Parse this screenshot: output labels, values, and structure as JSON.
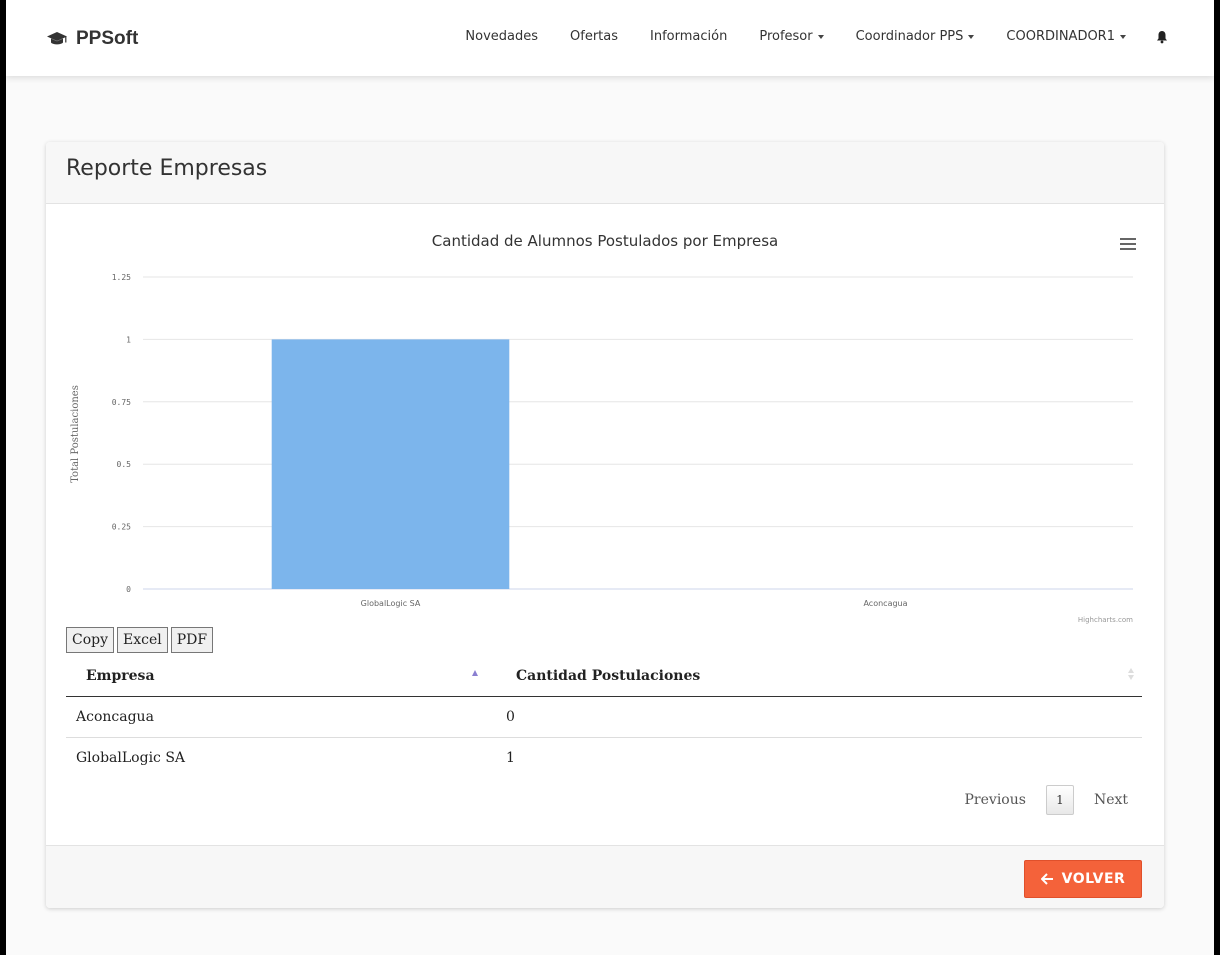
{
  "navbar": {
    "brand": "PPSoft",
    "items": [
      {
        "label": "Novedades",
        "dropdown": false
      },
      {
        "label": "Ofertas",
        "dropdown": false
      },
      {
        "label": "Información",
        "dropdown": false
      },
      {
        "label": "Profesor",
        "dropdown": true
      },
      {
        "label": "Coordinador PPS",
        "dropdown": true
      },
      {
        "label": "COORDINADOR1",
        "dropdown": true
      }
    ],
    "icons": {
      "brand": "graduation-cap-icon",
      "notifications": "bell-icon"
    }
  },
  "card": {
    "title": "Reporte Empresas"
  },
  "chart_data": {
    "type": "bar",
    "title": "Cantidad de Alumnos Postulados por Empresa",
    "ylabel": "Total Postulaciones",
    "xlabel": "",
    "categories": [
      "GlobalLogic SA",
      "Aconcagua"
    ],
    "values": [
      1,
      0
    ],
    "ylim": [
      0,
      1.25
    ],
    "yticks": [
      "0",
      "0.25",
      "0.5",
      "0.75",
      "1",
      "1.25"
    ],
    "credits": "Highcharts.com",
    "bar_color": "#7cb5ec",
    "grid": true
  },
  "export_buttons": [
    "Copy",
    "Excel",
    "PDF"
  ],
  "table": {
    "headers": [
      "Empresa",
      "Cantidad Postulaciones"
    ],
    "rows": [
      [
        "Aconcagua",
        "0"
      ],
      [
        "GlobalLogic SA",
        "1"
      ]
    ]
  },
  "pagination": {
    "previous": "Previous",
    "current": "1",
    "next": "Next"
  },
  "footer": {
    "back_button": "VOLVER"
  },
  "colors": {
    "accent": "#f4623a"
  }
}
